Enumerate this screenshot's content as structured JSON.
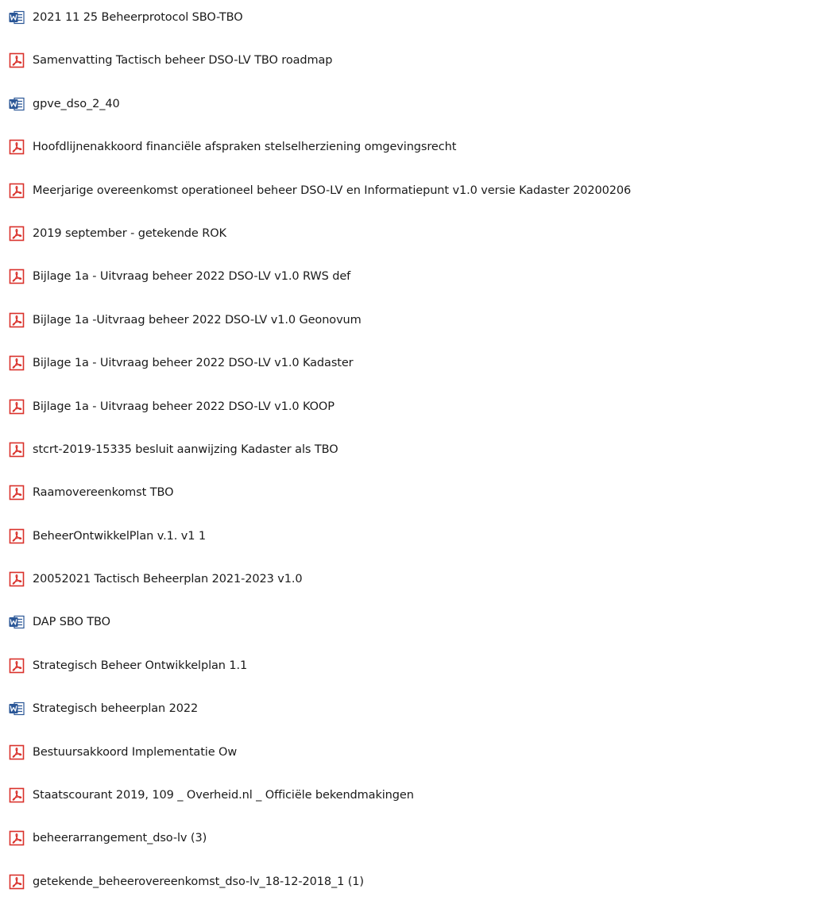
{
  "files": [
    {
      "name": "2021 11 25 Beheerprotocol SBO-TBO",
      "icon": "word-document-icon"
    },
    {
      "name": "Samenvatting Tactisch beheer DSO-LV TBO roadmap",
      "icon": "pdf-document-icon"
    },
    {
      "name": "gpve_dso_2_40",
      "icon": "word-document-icon"
    },
    {
      "name": "Hoofdlijnenakkoord financiële afspraken stelselherziening omgevingsrecht",
      "icon": "pdf-document-icon"
    },
    {
      "name": "Meerjarige overeenkomst operationeel beheer DSO-LV en Informatiepunt v1.0 versie Kadaster 20200206",
      "icon": "pdf-document-icon"
    },
    {
      "name": "2019 september - getekende ROK",
      "icon": "pdf-document-icon"
    },
    {
      "name": "Bijlage 1a - Uitvraag beheer 2022 DSO-LV v1.0 RWS def",
      "icon": "pdf-document-icon"
    },
    {
      "name": "Bijlage 1a -Uitvraag beheer 2022 DSO-LV v1.0 Geonovum",
      "icon": "pdf-document-icon"
    },
    {
      "name": "Bijlage 1a - Uitvraag beheer 2022 DSO-LV v1.0 Kadaster",
      "icon": "pdf-document-icon"
    },
    {
      "name": "Bijlage 1a - Uitvraag beheer 2022 DSO-LV v1.0 KOOP",
      "icon": "pdf-document-icon"
    },
    {
      "name": "stcrt-2019-15335 besluit aanwijzing Kadaster als TBO",
      "icon": "pdf-document-icon"
    },
    {
      "name": "Raamovereenkomst TBO",
      "icon": "pdf-document-icon"
    },
    {
      "name": "BeheerOntwikkelPlan v.1. v1 1",
      "icon": "pdf-document-icon"
    },
    {
      "name": "20052021 Tactisch Beheerplan 2021-2023 v1.0",
      "icon": "pdf-document-icon"
    },
    {
      "name": "DAP SBO TBO",
      "icon": "word-document-icon"
    },
    {
      "name": "Strategisch Beheer Ontwikkelplan 1.1",
      "icon": "pdf-document-icon"
    },
    {
      "name": "Strategisch beheerplan 2022",
      "icon": "word-document-icon"
    },
    {
      "name": "Bestuursakkoord Implementatie Ow",
      "icon": "pdf-document-icon"
    },
    {
      "name": "Staatscourant 2019, 109 _ Overheid.nl _ Officiële bekendmakingen",
      "icon": "pdf-document-icon"
    },
    {
      "name": "beheerarrangement_dso-lv (3)",
      "icon": "pdf-document-icon"
    },
    {
      "name": "getekende_beheerovereenkomst_dso-lv_18-12-2018_1 (1)",
      "icon": "pdf-document-icon"
    }
  ],
  "colors": {
    "pdf_accent": "#d9312b",
    "word_accent": "#2b5797",
    "text": "#1a1a1a"
  }
}
